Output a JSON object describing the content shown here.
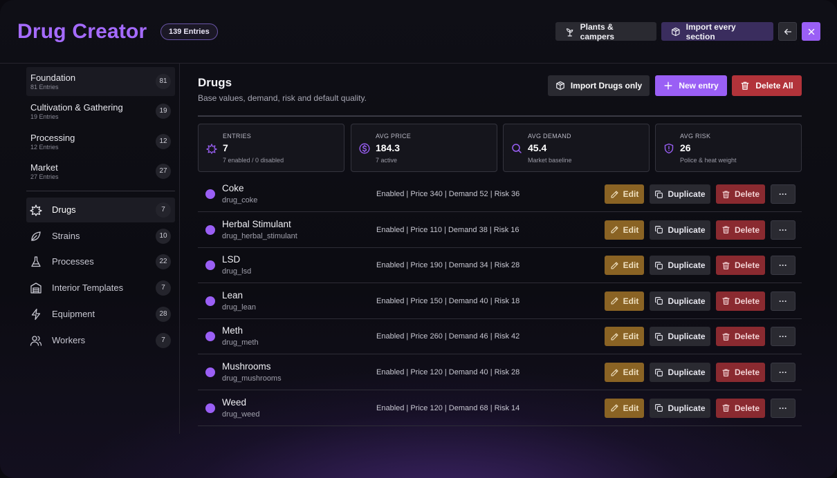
{
  "header": {
    "title": "Drug Creator",
    "entries_badge": "139 Entries",
    "plants_button": "Plants & campers",
    "import_all_button": "Import every section",
    "back_icon": "arrow-left-icon",
    "close_icon": "close-icon"
  },
  "sidebar": {
    "categories": [
      {
        "name": "Foundation",
        "sub": "81 Entries",
        "count": "81",
        "active": true
      },
      {
        "name": "Cultivation & Gathering",
        "sub": "19 Entries",
        "count": "19",
        "active": false
      },
      {
        "name": "Processing",
        "sub": "12 Entries",
        "count": "12",
        "active": false
      },
      {
        "name": "Market",
        "sub": "27 Entries",
        "count": "27",
        "active": false
      }
    ],
    "items": [
      {
        "label": "Drugs",
        "count": "7",
        "icon": "cannabis-leaf-icon",
        "active": true
      },
      {
        "label": "Strains",
        "count": "10",
        "icon": "leaf-icon",
        "active": false
      },
      {
        "label": "Processes",
        "count": "22",
        "icon": "flask-icon",
        "active": false
      },
      {
        "label": "Interior Templates",
        "count": "7",
        "icon": "warehouse-icon",
        "active": false
      },
      {
        "label": "Equipment",
        "count": "28",
        "icon": "lightning-icon",
        "active": false
      },
      {
        "label": "Workers",
        "count": "7",
        "icon": "users-icon",
        "active": false
      }
    ]
  },
  "main": {
    "title": "Drugs",
    "subtitle": "Base values, demand, risk and default quality.",
    "import_button": "Import Drugs only",
    "new_button": "New entry",
    "delete_all_button": "Delete All",
    "stats": [
      {
        "label": "ENTRIES",
        "value": "7",
        "note": "7 enabled / 0 disabled",
        "icon": "cannabis-leaf-icon"
      },
      {
        "label": "AVG PRICE",
        "value": "184.3",
        "note": "7 active",
        "icon": "dollar-circle-icon"
      },
      {
        "label": "AVG DEMAND",
        "value": "45.4",
        "note": "Market baseline",
        "icon": "search-icon"
      },
      {
        "label": "AVG RISK",
        "value": "26",
        "note": "Police & heat weight",
        "icon": "shield-alert-icon"
      }
    ],
    "row_actions": {
      "edit": "Edit",
      "duplicate": "Duplicate",
      "delete": "Delete",
      "more": "···"
    },
    "rows": [
      {
        "name": "Coke",
        "id": "drug_coke",
        "info": "Enabled | Price 340 | Demand 52 | Risk 36"
      },
      {
        "name": "Herbal Stimulant",
        "id": "drug_herbal_stimulant",
        "info": "Enabled | Price 110 | Demand 38 | Risk 16"
      },
      {
        "name": "LSD",
        "id": "drug_lsd",
        "info": "Enabled | Price 190 | Demand 34 | Risk 28"
      },
      {
        "name": "Lean",
        "id": "drug_lean",
        "info": "Enabled | Price 150 | Demand 40 | Risk 18"
      },
      {
        "name": "Meth",
        "id": "drug_meth",
        "info": "Enabled | Price 260 | Demand 46 | Risk 42"
      },
      {
        "name": "Mushrooms",
        "id": "drug_mushrooms",
        "info": "Enabled | Price 120 | Demand 40 | Risk 28"
      },
      {
        "name": "Weed",
        "id": "drug_weed",
        "info": "Enabled | Price 120 | Demand 68 | Risk 14"
      }
    ]
  },
  "colors": {
    "accent": "#9a5ff5",
    "title": "#a56bff",
    "edit": "#8a6324",
    "delete": "#8a2a30",
    "danger": "#b2333a"
  }
}
